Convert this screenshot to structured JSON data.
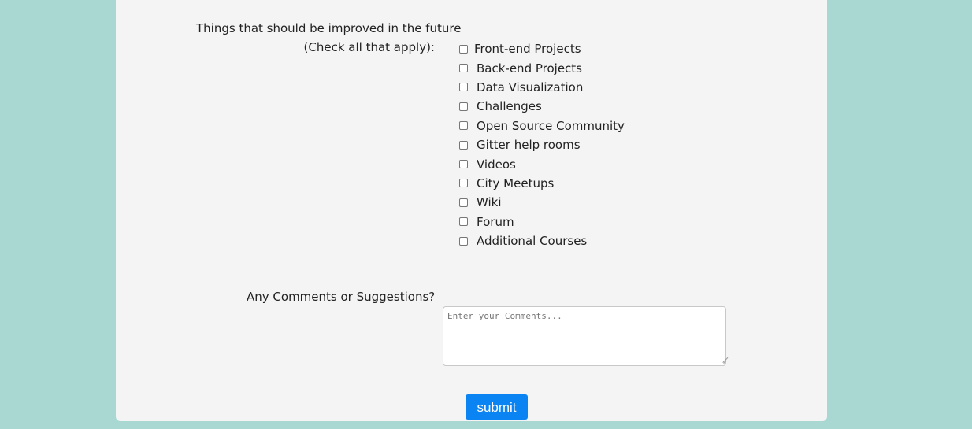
{
  "form": {
    "improvements": {
      "title": "Things that should be improved in the future",
      "subtitle": "(Check all that apply):",
      "options": [
        "Front-end Projects",
        "Back-end Projects",
        "Data Visualization",
        "Challenges",
        "Open Source Community",
        "Gitter help rooms",
        "Videos",
        "City Meetups",
        "Wiki",
        "Forum",
        "Additional Courses"
      ]
    },
    "comments": {
      "label": "Any Comments or Suggestions?",
      "placeholder": "Enter your Comments..."
    },
    "submit_label": "submit"
  },
  "colors": {
    "background": "#a9d8d3",
    "panel": "#f4f4f4",
    "submit": "#0b84f3"
  }
}
